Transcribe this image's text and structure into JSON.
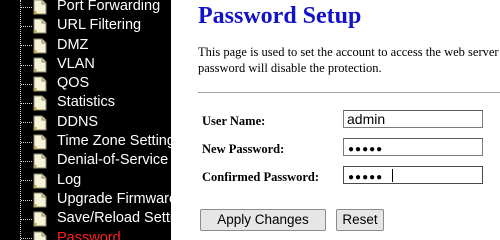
{
  "sidebar": {
    "items": [
      {
        "label": "Port Forwarding",
        "active": false
      },
      {
        "label": "URL Filtering",
        "active": false
      },
      {
        "label": "DMZ",
        "active": false
      },
      {
        "label": "VLAN",
        "active": false
      },
      {
        "label": "QOS",
        "active": false
      },
      {
        "label": "Statistics",
        "active": false
      },
      {
        "label": "DDNS",
        "active": false
      },
      {
        "label": "Time Zone Setting",
        "active": false
      },
      {
        "label": "Denial-of-Service",
        "active": false
      },
      {
        "label": "Log",
        "active": false
      },
      {
        "label": "Upgrade Firmware",
        "active": false
      },
      {
        "label": "Save/Reload Setting",
        "active": false
      },
      {
        "label": "Password",
        "active": true
      }
    ],
    "icon": "document-icon",
    "colors": {
      "background": "#000000",
      "text": "#ffffff",
      "active_text": "#ff2020"
    }
  },
  "main": {
    "title": "Password Setup",
    "description": "This page is used to set the account to access the web server of password will disable the protection.",
    "form": {
      "user_name_label": "User Name:",
      "user_name_value": "admin",
      "new_password_label": "New Password:",
      "new_password_mask": "●●●●●",
      "confirm_password_label": "Confirmed Password:",
      "confirm_password_mask": "●●●●●"
    },
    "buttons": {
      "apply_label": "Apply Changes",
      "reset_label": "Reset"
    },
    "colors": {
      "title": "#1212c8"
    }
  }
}
